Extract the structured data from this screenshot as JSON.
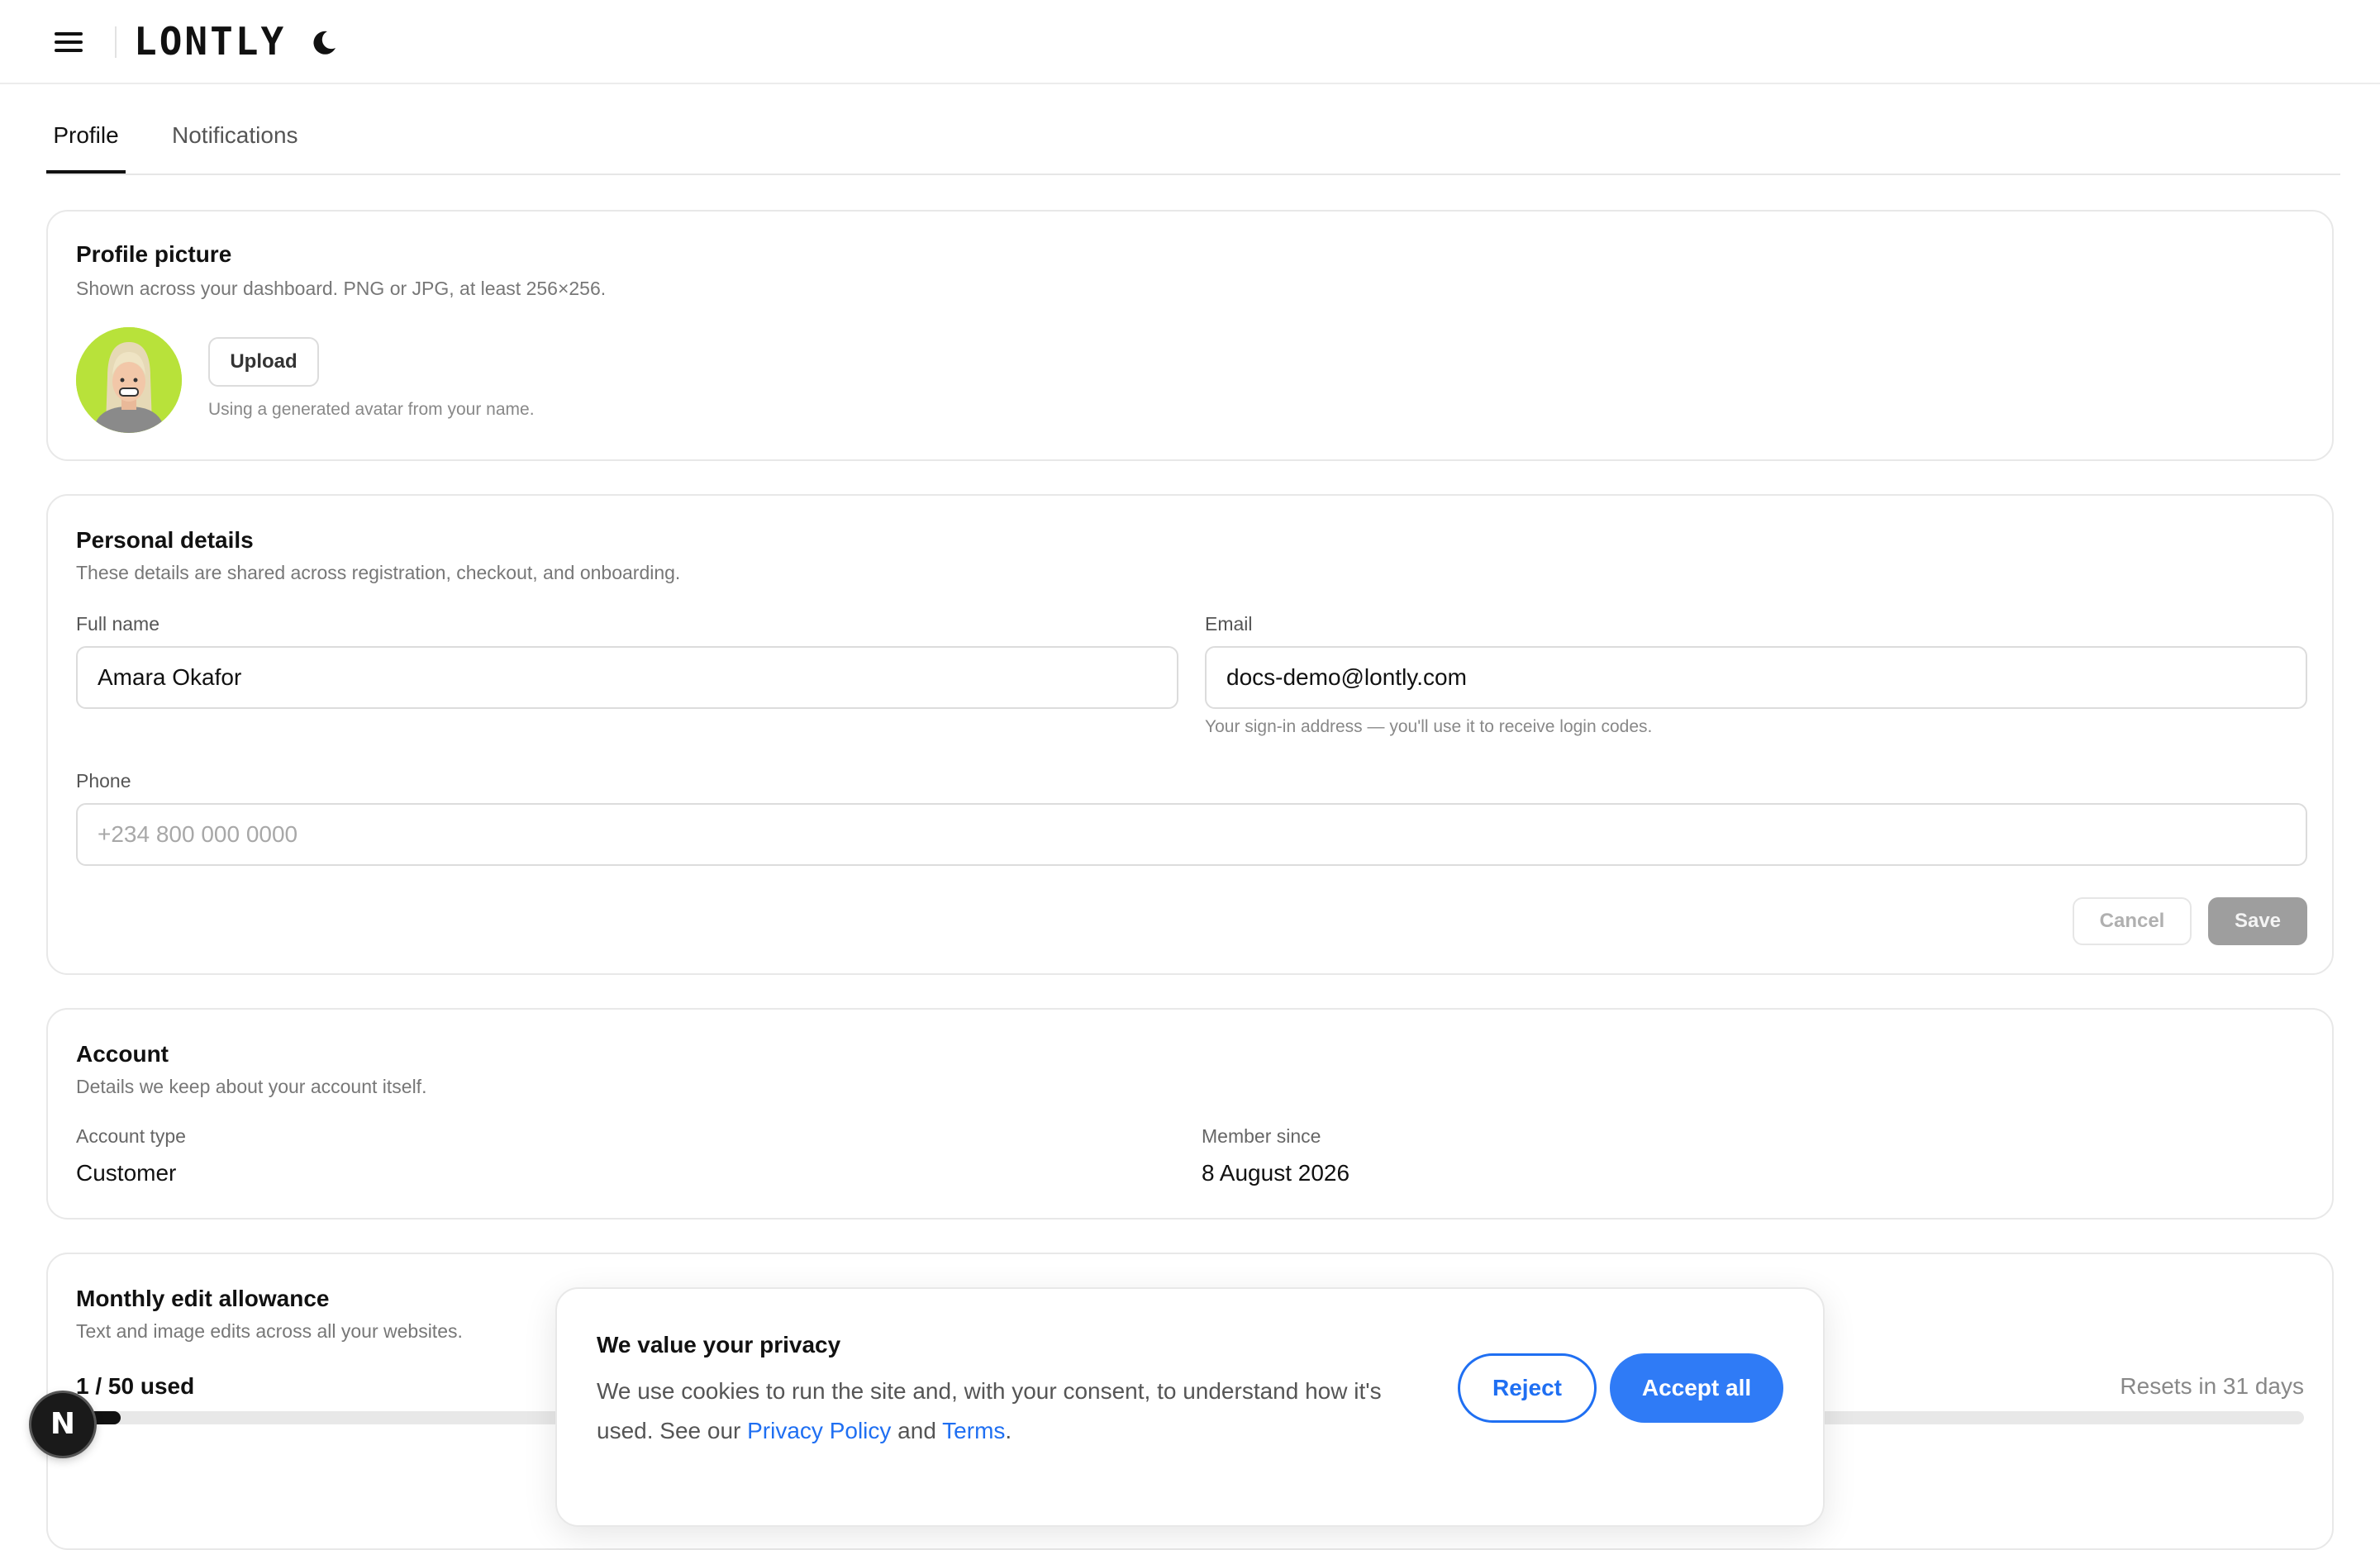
{
  "header": {
    "menu_icon": "hamburger-menu-icon",
    "logo_text": "LONTLY",
    "theme_icon": "moon-icon"
  },
  "tabs": [
    {
      "label": "Profile",
      "active": true
    },
    {
      "label": "Notifications",
      "active": false
    }
  ],
  "profile_picture": {
    "title": "Profile picture",
    "subtitle": "Shown across your dashboard. PNG or JPG, at least 256×256.",
    "upload_label": "Upload",
    "hint": "Using a generated avatar from your name."
  },
  "personal_details": {
    "title": "Personal details",
    "subtitle": "These details are shared across registration, checkout, and onboarding.",
    "full_name_label": "Full name",
    "full_name_value": "Amara Okafor",
    "email_label": "Email",
    "email_value": "docs-demo@lontly.com",
    "email_hint": "Your sign-in address — you'll use it to receive login codes.",
    "phone_label": "Phone",
    "phone_placeholder": "+234 800 000 0000",
    "cancel_label": "Cancel",
    "save_label": "Save"
  },
  "account": {
    "title": "Account",
    "subtitle": "Details we keep about your account itself.",
    "type_label": "Account type",
    "type_value": "Customer",
    "since_label": "Member since",
    "since_value": "8 August 2026"
  },
  "allowance": {
    "title": "Monthly edit allowance",
    "subtitle": "Text and image edits across all your websites.",
    "usage": "1 / 50 used",
    "used": 1,
    "limit": 50,
    "reset": "Resets in 31 days"
  },
  "cookie_banner": {
    "title": "We value your privacy",
    "body_part1": "We use cookies to run the site and, with your consent, to understand how it's used. See our ",
    "privacy_link": "Privacy Policy",
    "body_and": " and ",
    "terms_link": "Terms",
    "body_end": ".",
    "reject_label": "Reject",
    "accept_label": "Accept all",
    "accent_color": "#2f7bf6"
  },
  "dev_badge": {
    "letter": "N"
  }
}
